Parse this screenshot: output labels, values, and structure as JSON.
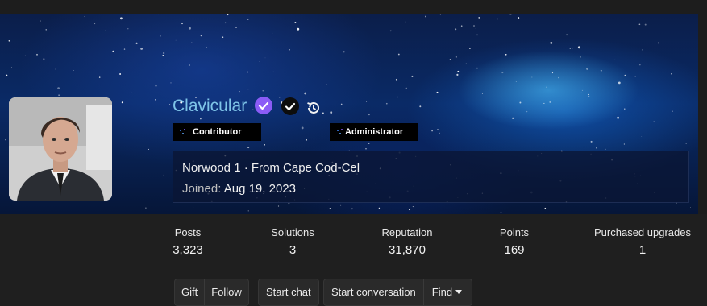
{
  "profile": {
    "username": "Clavicular",
    "badges": [
      {
        "label": "Contributor"
      },
      {
        "label": "Administrator"
      }
    ],
    "location_line": "Norwood 1 · From Cape Cod-Cel",
    "joined_label": "Joined:",
    "joined_value": "Aug 19, 2023",
    "icons": [
      "verified-badge-icon",
      "check-circle-icon",
      "history-icon"
    ]
  },
  "stats": [
    {
      "label": "Posts",
      "value": "3,323"
    },
    {
      "label": "Solutions",
      "value": "3"
    },
    {
      "label": "Reputation",
      "value": "31,870"
    },
    {
      "label": "Points",
      "value": "169"
    },
    {
      "label": "Purchased upgrades",
      "value": "1"
    }
  ],
  "actions": {
    "gift": "Gift",
    "follow": "Follow",
    "start_chat": "Start chat",
    "start_conversation": "Start conversation",
    "find": "Find"
  },
  "colors": {
    "username": "#7ec4e8",
    "verified": "#8b5cf6",
    "page_bg": "#1f1f1f"
  }
}
